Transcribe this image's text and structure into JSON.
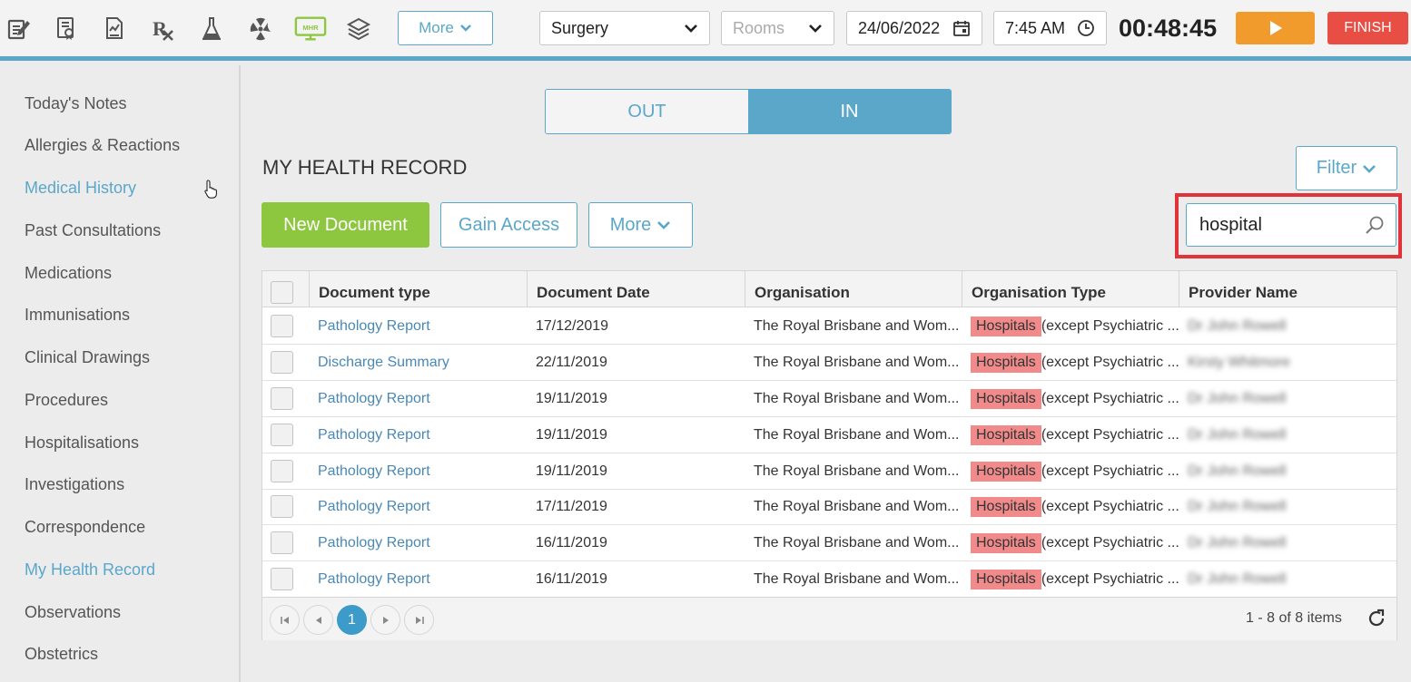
{
  "toolbar": {
    "icons": [
      "notes-edit-icon",
      "certificate-icon",
      "document-report-icon",
      "prescription-icon",
      "lab-flask-icon",
      "radiation-icon",
      "mhr-monitor-icon",
      "education-book-icon"
    ],
    "mhr_label": "MHR",
    "more_label": "More",
    "location_select": "Surgery",
    "rooms_placeholder": "Rooms",
    "date": "24/06/2022",
    "time": "7:45 AM",
    "timer": "00:48:45",
    "finish_label": "FINISH",
    "colors": {
      "play": "#f19b2c",
      "finish": "#e84e44",
      "accent": "#5aa7c9"
    }
  },
  "sidebar": {
    "items": [
      {
        "label": "Today's Notes",
        "active": false
      },
      {
        "label": "Allergies & Reactions",
        "active": false
      },
      {
        "label": "Medical History",
        "active": true
      },
      {
        "label": "Past Consultations",
        "active": false
      },
      {
        "label": "Medications",
        "active": false
      },
      {
        "label": "Immunisations",
        "active": false
      },
      {
        "label": "Clinical Drawings",
        "active": false
      },
      {
        "label": "Procedures",
        "active": false
      },
      {
        "label": "Hospitalisations",
        "active": false
      },
      {
        "label": "Investigations",
        "active": false
      },
      {
        "label": "Correspondence",
        "active": false
      },
      {
        "label": "My Health Record",
        "active": true
      },
      {
        "label": "Observations",
        "active": false
      },
      {
        "label": "Obstetrics",
        "active": false
      }
    ]
  },
  "main": {
    "toggle": {
      "out_label": "OUT",
      "in_label": "IN",
      "selected": "IN"
    },
    "title": "MY HEALTH RECORD",
    "filter_label": "Filter",
    "new_document_label": "New Document",
    "gain_access_label": "Gain Access",
    "more_label": "More",
    "search_value": "hospital",
    "table": {
      "columns": [
        "Document type",
        "Document Date",
        "Organisation",
        "Organisation Type",
        "Provider Name"
      ],
      "rows": [
        {
          "type": "Pathology Report",
          "date": "17/12/2019",
          "org": "The Royal Brisbane and Wom...",
          "org_type_hl": "Hospitals",
          "org_type_rest": "(except Psychiatric ...",
          "provider": "Dr John Rowell"
        },
        {
          "type": "Discharge Summary",
          "date": "22/11/2019",
          "org": "The Royal Brisbane and Wom...",
          "org_type_hl": "Hospitals",
          "org_type_rest": "(except Psychiatric ...",
          "provider": "Kirsty Whitmore"
        },
        {
          "type": "Pathology Report",
          "date": "19/11/2019",
          "org": "The Royal Brisbane and Wom...",
          "org_type_hl": "Hospitals",
          "org_type_rest": "(except Psychiatric ...",
          "provider": "Dr John Rowell"
        },
        {
          "type": "Pathology Report",
          "date": "19/11/2019",
          "org": "The Royal Brisbane and Wom...",
          "org_type_hl": "Hospitals",
          "org_type_rest": "(except Psychiatric ...",
          "provider": "Dr John Rowell"
        },
        {
          "type": "Pathology Report",
          "date": "19/11/2019",
          "org": "The Royal Brisbane and Wom...",
          "org_type_hl": "Hospitals",
          "org_type_rest": "(except Psychiatric ...",
          "provider": "Dr John Rowell"
        },
        {
          "type": "Pathology Report",
          "date": "17/11/2019",
          "org": "The Royal Brisbane and Wom...",
          "org_type_hl": "Hospitals",
          "org_type_rest": "(except Psychiatric ...",
          "provider": "Dr John Rowell"
        },
        {
          "type": "Pathology Report",
          "date": "16/11/2019",
          "org": "The Royal Brisbane and Wom...",
          "org_type_hl": "Hospitals",
          "org_type_rest": "(except Psychiatric ...",
          "provider": "Dr John Rowell"
        },
        {
          "type": "Pathology Report",
          "date": "16/11/2019",
          "org": "The Royal Brisbane and Wom...",
          "org_type_hl": "Hospitals",
          "org_type_rest": "(except Psychiatric ...",
          "provider": "Dr John Rowell"
        }
      ]
    },
    "pager": {
      "current_page": "1",
      "info": "1 - 8 of 8 items"
    }
  }
}
